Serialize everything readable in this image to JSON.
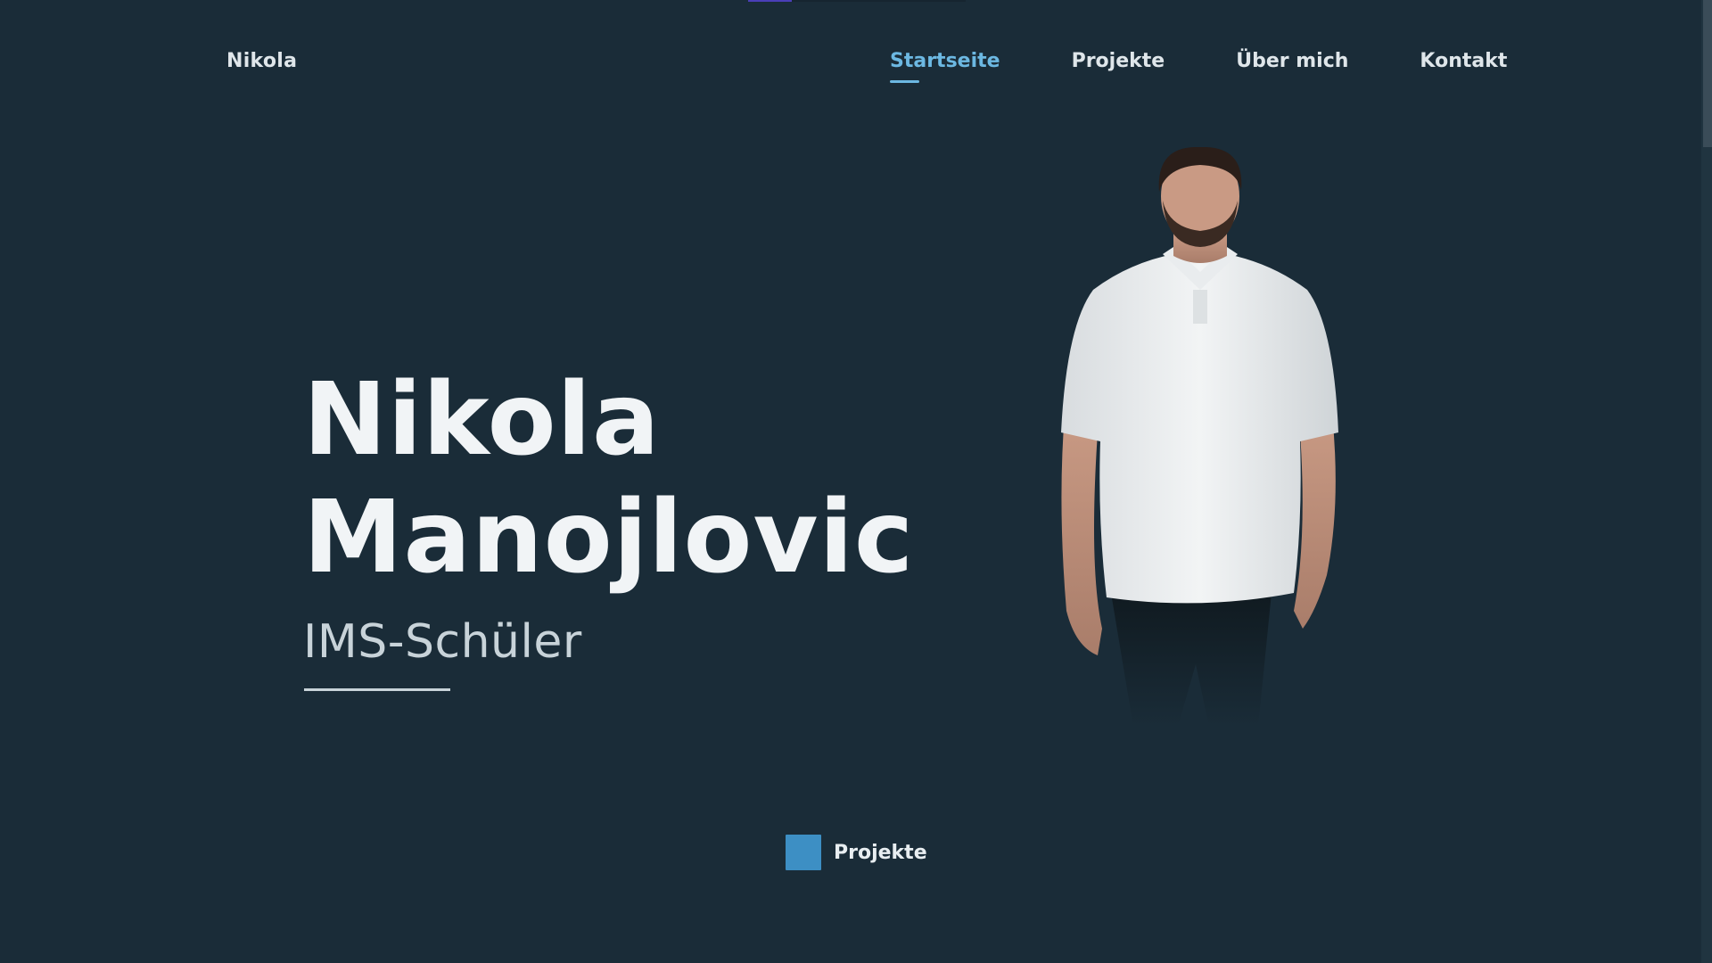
{
  "header": {
    "brand": "Nikola",
    "nav": [
      {
        "label": "Startseite",
        "active": true
      },
      {
        "label": "Projekte",
        "active": false
      },
      {
        "label": "Über mich",
        "active": false
      },
      {
        "label": "Kontakt",
        "active": false
      }
    ]
  },
  "hero": {
    "first_name": "Nikola",
    "last_name": "Manojlovic",
    "subtitle": "IMS-Schüler"
  },
  "cta": {
    "label": "Projekte",
    "icon": "square-icon"
  },
  "colors": {
    "background": "#1a2c38",
    "accent": "#6cb8e2",
    "cta_icon": "#3d8fc4"
  }
}
